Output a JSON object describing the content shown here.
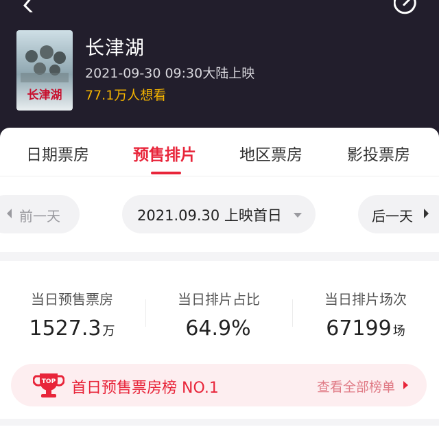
{
  "movie": {
    "title": "长津湖",
    "release": "2021-09-30 09:30大陆上映",
    "want_to_see": "77.1万人想看",
    "poster_title": "长津湖"
  },
  "tabs": [
    {
      "label": "日期票房"
    },
    {
      "label": "预售排片"
    },
    {
      "label": "地区票房"
    },
    {
      "label": "影投票房"
    }
  ],
  "active_tab": 1,
  "date_bar": {
    "prev_label": "前一天",
    "date_label": "2021.09.30 上映首日",
    "next_label": "后一天"
  },
  "stats": [
    {
      "label": "当日预售票房",
      "value": "1527.3",
      "unit": "万"
    },
    {
      "label": "当日排片占比",
      "value": "64.9%",
      "unit": ""
    },
    {
      "label": "当日排片场次",
      "value": "67199",
      "unit": "场"
    }
  ],
  "rank": {
    "badge_text": "TOP",
    "text": "首日预售票房榜 NO.1",
    "link": "查看全部榜单"
  },
  "icons": [
    "back-icon",
    "share-icon",
    "trophy-icon",
    "caret-down-icon",
    "arrow-left-icon",
    "arrow-right-icon"
  ],
  "colors": {
    "header_bg": "#221e2c",
    "accent": "#e8253a",
    "highlight": "#f4b400"
  }
}
